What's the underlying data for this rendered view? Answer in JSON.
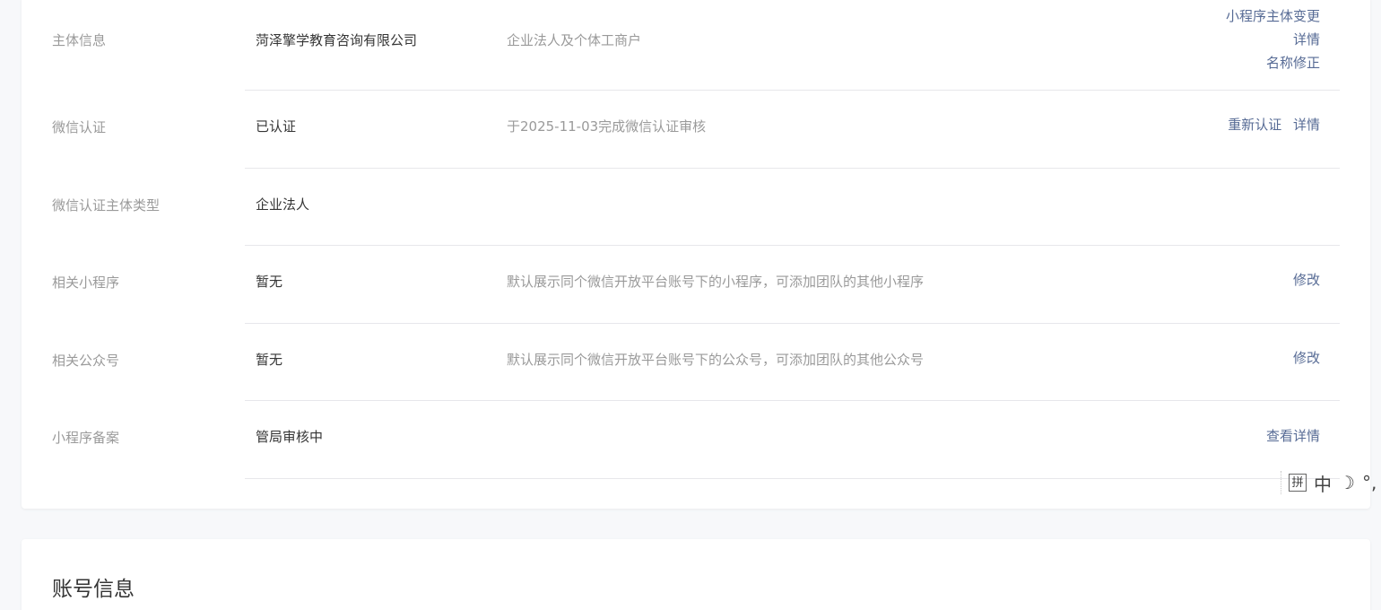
{
  "rows": [
    {
      "label": "主体信息",
      "value": "菏泽擎学教育咨询有限公司",
      "desc": "企业法人及个体工商户",
      "actions": [
        "小程序主体变更",
        "详情",
        "名称修正"
      ]
    },
    {
      "label": "微信认证",
      "value": "已认证",
      "desc": "于2025-11-03完成微信认证审核",
      "actions": [
        "重新认证",
        "详情"
      ]
    },
    {
      "label": "微信认证主体类型",
      "value": "企业法人",
      "desc": "",
      "actions": []
    },
    {
      "label": "相关小程序",
      "value": "暂无",
      "desc": "默认展示同个微信开放平台账号下的小程序，可添加团队的其他小程序",
      "actions": [
        "修改"
      ]
    },
    {
      "label": "相关公众号",
      "value": "暂无",
      "desc": "默认展示同个微信开放平台账号下的公众号，可添加团队的其他公众号",
      "actions": [
        "修改"
      ]
    },
    {
      "label": "小程序备案",
      "value": "管局审核中",
      "desc": "",
      "actions": [
        "查看详情"
      ]
    }
  ],
  "account_section": {
    "title": "账号信息"
  },
  "ime_toolbar": {
    "mode_glyph": "拼",
    "lang_glyph": "中",
    "moon_glyph": "☽",
    "punct_glyph": "°,"
  },
  "colors": {
    "link": "#576b95",
    "label": "#9a9a9a",
    "value": "#353535",
    "divider": "#e7e7eb"
  }
}
